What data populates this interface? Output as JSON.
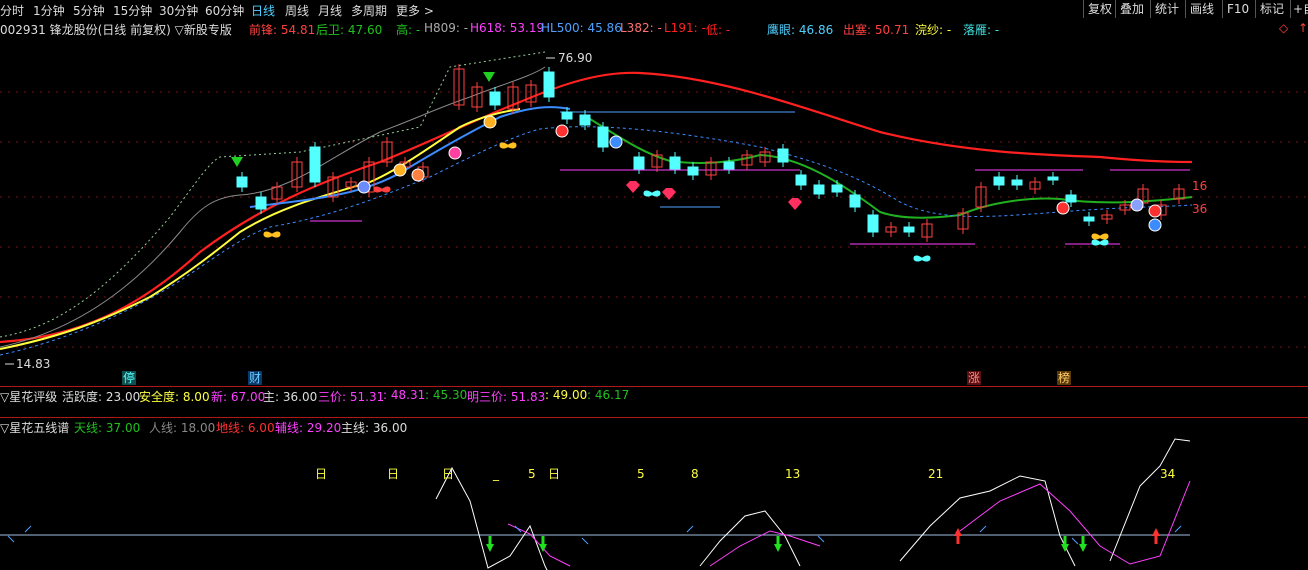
{
  "toolbar": {
    "timeframes": [
      "分时",
      "1分钟",
      "5分钟",
      "15分钟",
      "30分钟",
      "60分钟",
      "日线",
      "周线",
      "月线",
      "多周期",
      "更多 >"
    ],
    "active_timeframe": "日线",
    "right_buttons": [
      "复权",
      "叠加",
      "统计",
      "画线",
      "F10",
      "标记",
      "+自"
    ]
  },
  "info": {
    "title": "002931 锋龙股份(日线 前复权) ▽新股专版",
    "qian_feng": "前锋: 54.81",
    "hou_wei": "后卫: 47.60",
    "gao": "高: -",
    "h809": "H809: -",
    "h618": "H618: 53.19",
    "hl500": "HL500: 45.86",
    "l382": "L382: -",
    "l191": "L191: -",
    "di": "低: -",
    "ying_yan": "鹰眼: 46.86",
    "chu_sai": "出塞: 50.71",
    "wan_sha": "浣纱: -",
    "luo_yan": "落雁: -",
    "diamond": "◇",
    "arrow": "↑"
  },
  "price_chart": {
    "high_label": "76.90",
    "low_label": "14.83",
    "right_label_1": "16",
    "right_label_2": "36",
    "markers": [
      "停",
      "财",
      "涨",
      "榜"
    ]
  },
  "panel1": {
    "name": "▽星花评级",
    "huoyue": "活跃度: 23.00",
    "anquan": "安全度: 8.00",
    "xin": "新: 67.00",
    "zhu": "主: 36.00",
    "sanjia": "三价: 51.31",
    "sanjia2": ": 48.31",
    "sanjia3": ": 45.30",
    "mingsanjia": "明三价: 51.83",
    "ms2": ": 49.00",
    "ms3": ": 46.17"
  },
  "panel2": {
    "name": "▽星花五线谱",
    "tianxian": "天线: 37.00",
    "renxian": "人线: 18.00",
    "dixian": "地线: 6.00",
    "fuxian": "辅线: 29.20",
    "zhuxian": "主线: 36.00",
    "day_labels": [
      "日",
      "日",
      "日",
      "_",
      "5",
      "日",
      "5",
      "8",
      "13",
      "21",
      "34"
    ]
  },
  "colors": {
    "up": "#ff4040",
    "down": "#54ffff",
    "ma_red": "#ff2020",
    "ma_yellow": "#ffff40",
    "ma_blue": "#3c8cff",
    "ma_green": "#20b020",
    "grid": "#7a1010",
    "separator": "#b01818"
  }
}
